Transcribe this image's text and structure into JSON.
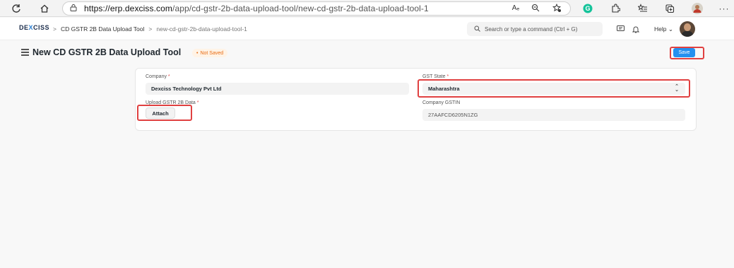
{
  "browser": {
    "url_host": "https://erp.dexciss.com",
    "url_path": "/app/cd-gstr-2b-data-upload-tool/new-cd-gstr-2b-data-upload-tool-1",
    "reader_label": "Aₑ"
  },
  "navbar": {
    "logo_prefix": "DE",
    "logo_x": "X",
    "logo_suffix": "CISS",
    "breadcrumbs": [
      "CD GSTR 2B Data Upload Tool",
      "new-cd-gstr-2b-data-upload-tool-1"
    ],
    "breadcrumb_sep": ">",
    "search_placeholder": "Search or type a command (Ctrl + G)",
    "help_label": "Help"
  },
  "page": {
    "title": "New CD GSTR 2B Data Upload Tool",
    "status": "Not Saved",
    "save_label": "Save"
  },
  "form": {
    "company_label": "Company",
    "company_value": "Dexciss Technology Pvt Ltd",
    "gst_state_label": "GST State",
    "gst_state_value": "Maharashtra",
    "upload_label": "Upload GSTR 2B Data",
    "attach_label": "Attach",
    "gstin_label": "Company GSTIN",
    "gstin_value": "27AAFCD6205N1ZG",
    "required_mark": "*"
  },
  "colors": {
    "primary": "#2490ef",
    "highlight": "#e04141",
    "status_text": "#e86c13"
  }
}
